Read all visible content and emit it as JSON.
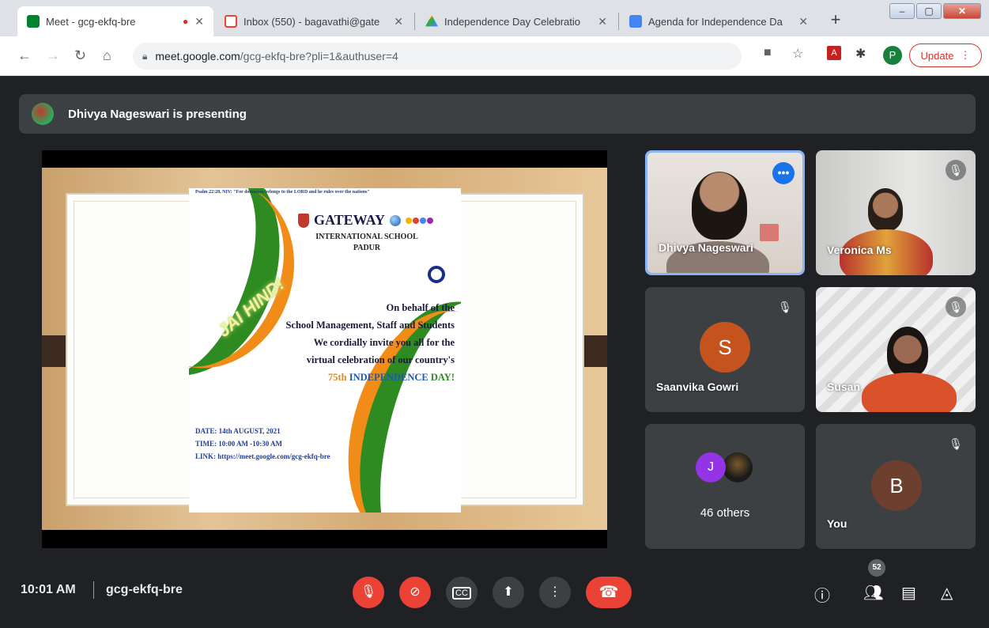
{
  "browser": {
    "tabs": [
      {
        "title": "Meet - gcg-ekfq-bre",
        "active": true,
        "favicon_color": "#00832d"
      },
      {
        "title": "Inbox (550) - bagavathi@gate",
        "active": false,
        "favicon_color": "#ea4335"
      },
      {
        "title": "Independence Day Celebratio",
        "active": false,
        "favicon_color": "#fbbc04"
      },
      {
        "title": "Agenda for Independence Da",
        "active": false,
        "favicon_color": "#4285f4"
      }
    ],
    "url_host": "meet.google.com",
    "url_path": "/gcg-ekfq-bre?pli=1&authuser=4",
    "profile_initial": "P",
    "update_label": "Update"
  },
  "presenting": {
    "text": "Dhivya Nageswari is presenting"
  },
  "slide": {
    "psalm": "Psalm 22:28, NIV: \"For dominion belongs to the LORD and he rules over the nations\"",
    "school_name": "GATEWAY",
    "school_sub": "INTERNATIONAL SCHOOL",
    "place": "PADUR",
    "jai_hind": "JAI HIND!",
    "lines": [
      "On behalf of the",
      "School Management, Staff and Students",
      "We cordially invite you all for the",
      "virtual celebration of our country's"
    ],
    "num_75": "75th",
    "independence": "INDEPENDENCE",
    "day": "DAY!",
    "date": "DATE: 14th AUGUST, 2021",
    "time": "TIME: 10:00 AM -10:30 AM",
    "link": "LINK: https://meet.google.com/gcg-ekfq-bre"
  },
  "participants": {
    "p1": {
      "name": "Dhivya Nageswari"
    },
    "p2": {
      "name": "Veronica Ms"
    },
    "p3": {
      "name": "Saanvika Gowri",
      "initial": "S",
      "color": "#c5531e"
    },
    "p4": {
      "name": "Susan"
    },
    "others": {
      "label": "46 others",
      "initial": "J",
      "color": "#9334e6"
    },
    "you": {
      "name": "You",
      "initial": "B",
      "color": "#6d3f2e"
    }
  },
  "bottom": {
    "time": "10:01 AM",
    "meeting_code": "gcg-ekfq-bre",
    "participant_count": "52"
  }
}
